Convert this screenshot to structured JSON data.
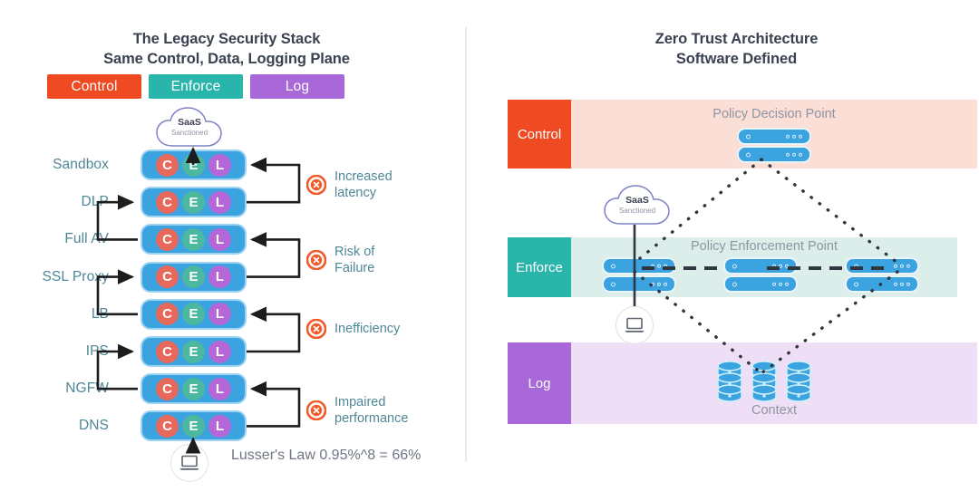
{
  "left": {
    "title_line1": "The Legacy Security Stack",
    "title_line2": "Same Control, Data, Logging Plane",
    "legend": [
      {
        "label": "Control",
        "color": "#F04A23"
      },
      {
        "label": "Enforce",
        "color": "#2AB5AB"
      },
      {
        "label": "Log",
        "color": "#A968D9"
      }
    ],
    "cloud": {
      "title": "SaaS",
      "subtitle": "Sanctioned"
    },
    "stack_rows": [
      {
        "label": "Sandbox",
        "badges": [
          "C",
          "E",
          "L"
        ]
      },
      {
        "label": "DLP",
        "badges": [
          "C",
          "E",
          "L"
        ]
      },
      {
        "label": "Full AV",
        "badges": [
          "C",
          "E",
          "L"
        ]
      },
      {
        "label": "SSL Proxy",
        "badges": [
          "C",
          "E",
          "L"
        ]
      },
      {
        "label": "LB",
        "badges": [
          "C",
          "E",
          "L"
        ]
      },
      {
        "label": "IPS",
        "badges": [
          "C",
          "E",
          "L"
        ]
      },
      {
        "label": "NGFW",
        "badges": [
          "C",
          "E",
          "L"
        ]
      },
      {
        "label": "DNS",
        "badges": [
          "C",
          "E",
          "L"
        ]
      }
    ],
    "issues": [
      {
        "text": "Increased\nlatency"
      },
      {
        "text": "Risk of\nFailure"
      },
      {
        "text": "Inefficiency"
      },
      {
        "text": "Impaired\nperformance"
      }
    ],
    "footnote": "Lusser's Law 0.95%^8 = 66%"
  },
  "right": {
    "title_line1": "Zero Trust Architecture",
    "title_line2": "Software Defined",
    "cloud": {
      "title": "SaaS",
      "subtitle": "Sanctioned"
    },
    "bands": [
      {
        "key": "Control",
        "key_color": "#F04A23",
        "body_color": "#FBDED5",
        "title": "Policy Decision Point",
        "title_position": "top"
      },
      {
        "key": "Enforce",
        "key_color": "#2AB5AB",
        "body_color": "#DCEEEA",
        "title": "Policy Enforcement Point",
        "title_position": "top"
      },
      {
        "key": "Log",
        "key_color": "#A968D9",
        "body_color": "#EEDFF7",
        "title": "Context",
        "title_position": "bottom"
      }
    ]
  },
  "colors": {
    "badge_control": "#E8695C",
    "badge_enforce": "#4CB89F",
    "badge_log": "#B567D8",
    "stack_row": "#3BA3E0",
    "server": "#3BA3E0",
    "label_text": "#4E8796",
    "issue_icon": "#F15A2B",
    "divider": "#ECECEE"
  }
}
